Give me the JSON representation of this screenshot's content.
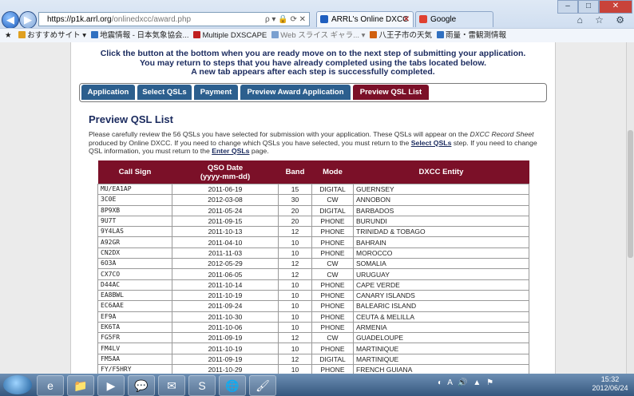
{
  "browser": {
    "address_host": "https://p1k.arrl.org",
    "address_path": "/onlinedxcc/award.php",
    "address_icons": "ρ ▾ 🔒 ⟳ ✕",
    "tabs": [
      {
        "label": "ARRL's Online DXCC",
        "icon_color": "#1f5fbf"
      },
      {
        "label": "Google",
        "icon_color": "#e04030"
      }
    ],
    "favorites": [
      {
        "label": "おすすめサイト ▾",
        "icon_color": "#e0a020",
        "dim": false
      },
      {
        "label": "地震情報 - 日本気象協会...",
        "icon_color": "#3070c0",
        "dim": false
      },
      {
        "label": "Multiple DXSCAPE",
        "icon_color": "#c02020",
        "dim": false
      },
      {
        "label": "Web スライス ギャラ... ▾",
        "icon_color": "#7aa0d0",
        "dim": true
      },
      {
        "label": "八王子市の天気",
        "icon_color": "#d06010",
        "dim": false
      },
      {
        "label": "雨量・雷観測情報",
        "icon_color": "#3070c0",
        "dim": false
      }
    ],
    "window_controls": [
      "–",
      "□",
      "✕"
    ],
    "home_icons": "⌂ ☆ ⚙"
  },
  "page": {
    "intro_lines": [
      "Click the button at the bottom when you are ready move on to the next step of submitting your application.",
      "You may return to steps that you have already completed using the tabs located below.",
      "A new tab appears after each step is successfully completed."
    ],
    "steps": [
      {
        "label": "Application",
        "active": false
      },
      {
        "label": "Select QSLs",
        "active": false
      },
      {
        "label": "Payment",
        "active": false
      },
      {
        "label": "Preview Award Application",
        "active": false
      },
      {
        "label": "Preview QSL List",
        "active": true
      }
    ],
    "heading": "Preview QSL List",
    "para": {
      "t1": "Please carefully review the 56 QSLs you have selected for submission with your application. These QSLs will appear on the ",
      "t2": "DXCC Record Sheet",
      "t3": " produced by Online DXCC. If you need to change which QSLs you have selected, you must return to the ",
      "link1": "Select QSLs",
      "t4": " step. If you need to change QSL information, you must return to the ",
      "link2": "Enter QSLs",
      "t5": " page."
    },
    "table": {
      "headers": [
        "Call Sign",
        "QSO Date\n(yyyy-mm-dd)",
        "Band",
        "Mode",
        "DXCC Entity"
      ],
      "rows": [
        [
          "MU/EA1AP",
          "2011-06-19",
          "15",
          "DIGITAL",
          "GUERNSEY"
        ],
        [
          "3C0E",
          "2012-03-08",
          "30",
          "CW",
          "ANNOBON"
        ],
        [
          "8P9XB",
          "2011-05-24",
          "20",
          "DIGITAL",
          "BARBADOS"
        ],
        [
          "9U7T",
          "2011-09-15",
          "20",
          "PHONE",
          "BURUNDI"
        ],
        [
          "9Y4LAS",
          "2011-10-13",
          "12",
          "PHONE",
          "TRINIDAD & TOBAGO"
        ],
        [
          "A92GR",
          "2011-04-10",
          "10",
          "PHONE",
          "BAHRAIN"
        ],
        [
          "CN2DX",
          "2011-11-03",
          "10",
          "PHONE",
          "MOROCCO"
        ],
        [
          "6O3A",
          "2012-05-29",
          "12",
          "CW",
          "SOMALIA"
        ],
        [
          "CX7CO",
          "2011-06-05",
          "12",
          "CW",
          "URUGUAY"
        ],
        [
          "D44AC",
          "2011-10-14",
          "10",
          "PHONE",
          "CAPE VERDE"
        ],
        [
          "EA8BWL",
          "2011-10-19",
          "10",
          "PHONE",
          "CANARY ISLANDS"
        ],
        [
          "EC6AAE",
          "2011-09-24",
          "10",
          "PHONE",
          "BALEARIC ISLAND"
        ],
        [
          "EF9A",
          "2011-10-30",
          "10",
          "PHONE",
          "CEUTA & MELILLA"
        ],
        [
          "EK6TA",
          "2011-10-06",
          "10",
          "PHONE",
          "ARMENIA"
        ],
        [
          "FG5FR",
          "2011-09-19",
          "12",
          "CW",
          "GUADELOUPE"
        ],
        [
          "FM4LV",
          "2011-10-19",
          "10",
          "PHONE",
          "MARTINIQUE"
        ],
        [
          "FM5AA",
          "2011-09-19",
          "12",
          "DIGITAL",
          "MARTINIQUE"
        ],
        [
          "FY/F5HRY",
          "2011-10-29",
          "10",
          "PHONE",
          "FRENCH GUIANA"
        ]
      ]
    }
  },
  "taskbar": {
    "apps": [
      "e",
      "📁",
      "▶",
      "💬",
      "✉",
      "S",
      "🌐",
      "🖌"
    ],
    "tray": "◐ A 🔊 ▲ ⚑",
    "time": "15:32",
    "date": "2012/06/24"
  }
}
